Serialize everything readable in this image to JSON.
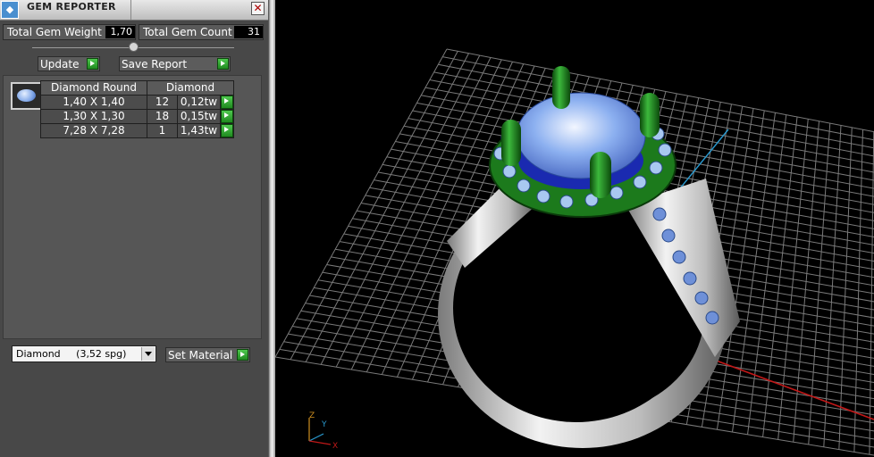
{
  "window": {
    "title": "GEM REPORTER",
    "icon": "gem-reporter-app-icon"
  },
  "stats": {
    "total_weight_label": "Total Gem Weight",
    "total_weight_value": "1,70",
    "total_count_label": "Total Gem Count",
    "total_count_value": "31"
  },
  "toolbar": {
    "update_label": "Update",
    "save_report_label": "Save Report"
  },
  "table": {
    "headers": [
      "Diamond Round",
      "Diamond"
    ],
    "rows": [
      {
        "size": "1,40 X 1,40",
        "count": "12",
        "weight": "0,12tw"
      },
      {
        "size": "1,30 X 1,30",
        "count": "18",
        "weight": "0,15tw"
      },
      {
        "size": "7,28 X 7,28",
        "count": "1",
        "weight": "1,43tw"
      }
    ]
  },
  "material": {
    "selected": "Diamond     (3,52 spg)",
    "set_label": "Set Material"
  },
  "viewport": {
    "axis_labels": {
      "z": "Z",
      "y": "Y",
      "x": "X"
    },
    "colors": {
      "grid": "#7a7a7a",
      "x_axis": "#c01818",
      "y_axis": "#2a9ad0",
      "metal": "#d8d8d8",
      "prongs": "#1c7a1c",
      "center_stone": "#8cb0f0",
      "halo_stones": "#a8c8f0"
    }
  }
}
